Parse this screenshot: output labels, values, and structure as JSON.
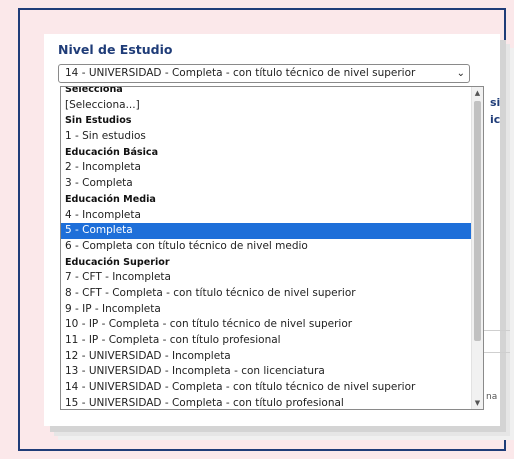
{
  "field": {
    "label": "Nivel de Estudio",
    "selected_value": "14 - UNIVERSIDAD - Completa - con título técnico de nivel superior"
  },
  "peek": {
    "top_right_1": "si",
    "top_right_2": "ic",
    "bottom_right": "na"
  },
  "dropdown": {
    "options": [
      {
        "label": "Selecciona",
        "type": "group"
      },
      {
        "label": "[Selecciona...]",
        "type": "option"
      },
      {
        "label": "Sin Estudios",
        "type": "group"
      },
      {
        "label": "1 - Sin estudios",
        "type": "option"
      },
      {
        "label": "Educación Básica",
        "type": "group"
      },
      {
        "label": "2 - Incompleta",
        "type": "option"
      },
      {
        "label": "3 - Completa",
        "type": "option"
      },
      {
        "label": "Educación Media",
        "type": "group"
      },
      {
        "label": "4 - Incompleta",
        "type": "option"
      },
      {
        "label": "5 - Completa",
        "type": "option",
        "highlighted": true
      },
      {
        "label": "6 - Completa con título técnico de nivel medio",
        "type": "option"
      },
      {
        "label": "Educación Superior",
        "type": "group"
      },
      {
        "label": "7 - CFT - Incompleta",
        "type": "option"
      },
      {
        "label": "8 - CFT - Completa - con título técnico de nivel superior",
        "type": "option"
      },
      {
        "label": "9 - IP - Incompleta",
        "type": "option"
      },
      {
        "label": "10 - IP - Completa - con título técnico de nivel superior",
        "type": "option"
      },
      {
        "label": "11 - IP - Completa - con título profesional",
        "type": "option"
      },
      {
        "label": "12 - UNIVERSIDAD - Incompleta",
        "type": "option"
      },
      {
        "label": "13 - UNIVERSIDAD - Incompleta - con licenciatura",
        "type": "option"
      },
      {
        "label": "14 - UNIVERSIDAD - Completa - con título técnico de nivel superior",
        "type": "option"
      },
      {
        "label": "15 - UNIVERSIDAD - Completa - con título profesional",
        "type": "option"
      }
    ]
  },
  "icons": {
    "select_chevron": "chevron-down-icon",
    "scroll_up": "triangle-up-icon",
    "scroll_down": "triangle-down-icon"
  },
  "colors": {
    "background": "#fbe8ea",
    "frame_border": "#1f3c78",
    "label": "#1f3c78",
    "highlight": "#1e6fd9"
  }
}
